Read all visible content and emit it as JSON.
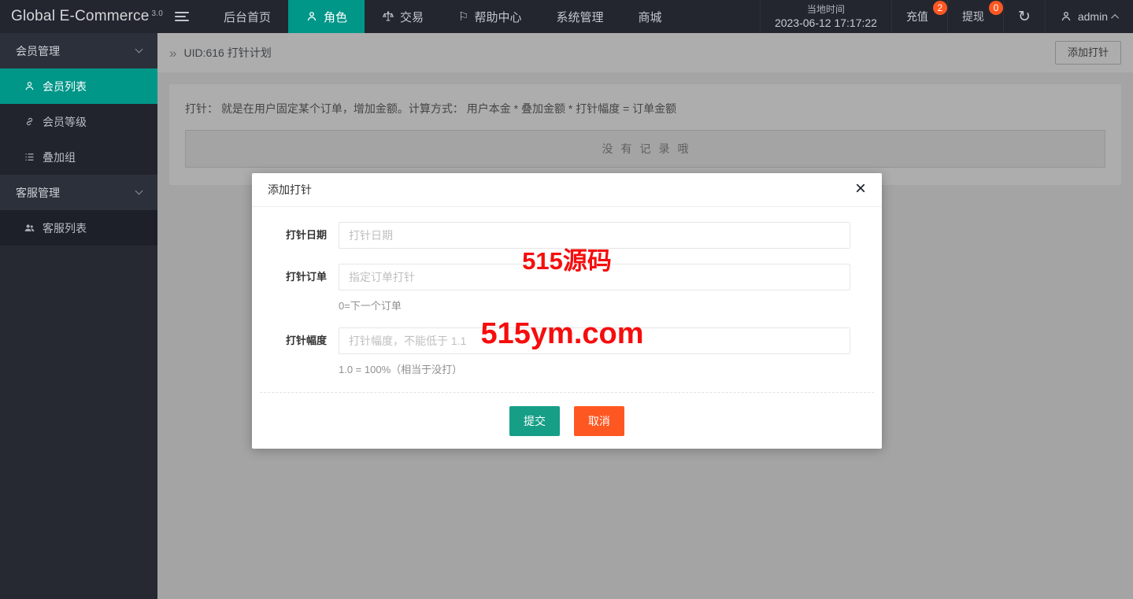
{
  "brand": {
    "name": "Global E-Commerce",
    "version": "3.0"
  },
  "topnav": {
    "items": [
      {
        "label": "后台首页",
        "active": false
      },
      {
        "label": "角色",
        "active": true,
        "icon": "person-icon"
      },
      {
        "label": "交易",
        "active": false,
        "icon": "scales-icon"
      },
      {
        "label": "帮助中心",
        "active": false,
        "icon": "flag-icon"
      },
      {
        "label": "系统管理",
        "active": false
      },
      {
        "label": "商城",
        "active": false
      }
    ]
  },
  "topbar_right": {
    "time_label": "当地时间",
    "time_value": "2023-06-12 17:17:22",
    "recharge_label": "充值",
    "recharge_badge": "2",
    "withdraw_label": "提现",
    "withdraw_badge": "0",
    "username": "admin"
  },
  "sidebar": {
    "groups": [
      {
        "label": "会员管理",
        "items": [
          {
            "label": "会员列表",
            "active": true,
            "icon": "person-icon"
          },
          {
            "label": "会员等级",
            "active": false,
            "icon": "link-icon"
          },
          {
            "label": "叠加组",
            "active": false,
            "icon": "list-icon"
          }
        ]
      },
      {
        "label": "客服管理",
        "items": [
          {
            "label": "客服列表",
            "active": false,
            "icon": "people-icon"
          }
        ]
      }
    ]
  },
  "breadcrumb": {
    "title": "UID:616 打针计划",
    "add_button": "添加打针"
  },
  "content": {
    "tip": "打针： 就是在用户固定某个订单，增加金额。计算方式： 用户本金 * 叠加金额 * 打针幅度 = 订单金额",
    "empty_text": "没有记录哦"
  },
  "modal": {
    "title": "添加打针",
    "fields": [
      {
        "label": "打针日期",
        "placeholder": "打针日期",
        "hint": ""
      },
      {
        "label": "打针订单",
        "placeholder": "指定订单打针",
        "hint": "0=下一个订单"
      },
      {
        "label": "打针幅度",
        "placeholder": "打针幅度，不能低于 1.1",
        "hint": "1.0 = 100%（相当于没打）"
      }
    ],
    "submit_label": "提交",
    "cancel_label": "取消"
  },
  "watermarks": {
    "line1": "515源码",
    "line2": "515ym.com"
  },
  "icons": {
    "breadcrumb": "»",
    "close": "×",
    "refresh": "↻",
    "flag": "⚐"
  },
  "colors": {
    "accent": "#009688",
    "danger": "#ff5722",
    "submit": "#169e86",
    "watermark": "#f60d0d"
  }
}
